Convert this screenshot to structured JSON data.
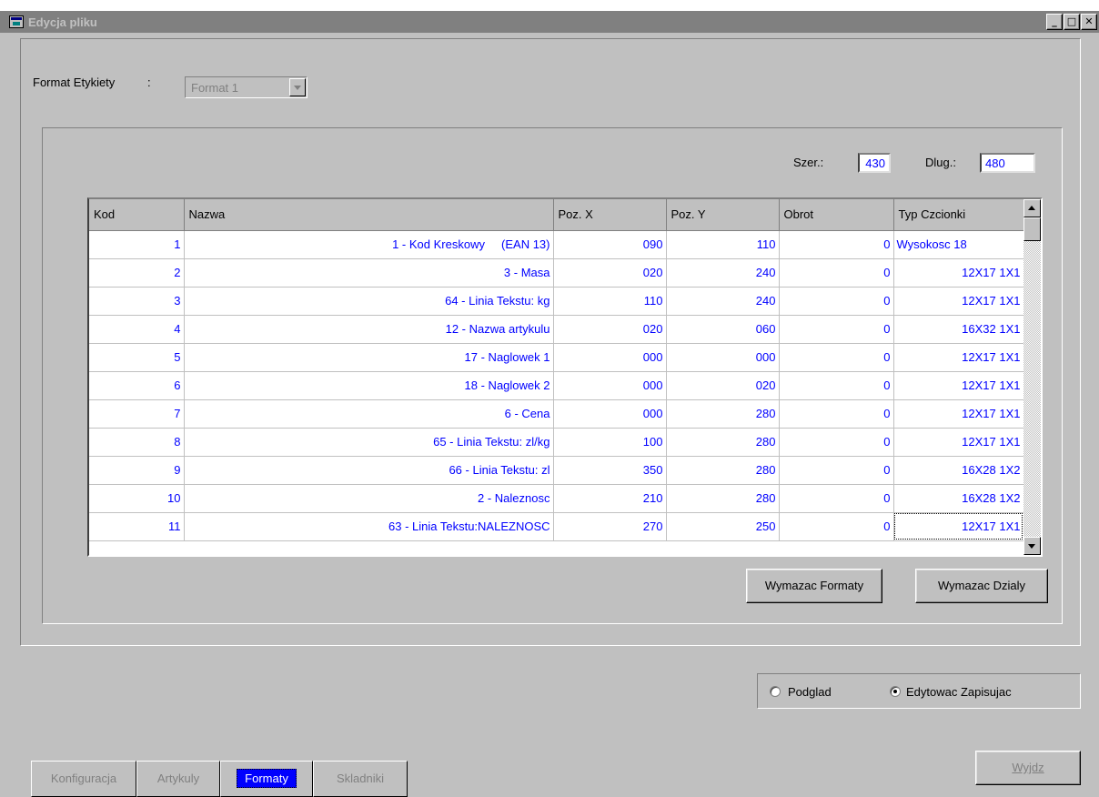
{
  "window": {
    "title": "Edycja pliku",
    "minimize": "_",
    "maximize": "□",
    "close": "✕"
  },
  "format": {
    "label": "Format Etykiety",
    "colon": ":",
    "value": "Format 1"
  },
  "dims": {
    "szer_label": "Szer.:",
    "szer_value": "430",
    "dlug_label": "Dlug.:",
    "dlug_value": "480"
  },
  "table": {
    "columns": [
      "Kod",
      "Nazwa",
      "Poz. X",
      "Poz. Y",
      "Obrot",
      "Typ Czcionki"
    ],
    "rows": [
      {
        "kod": "1",
        "nazwa": "1 - Kod Kreskowy     (EAN 13)",
        "x": "090",
        "y": "110",
        "obrot": "0",
        "typ": "Wysokosc 18"
      },
      {
        "kod": "2",
        "nazwa": "3 - Masa",
        "x": "020",
        "y": "240",
        "obrot": "0",
        "typ": "12X17 1X1"
      },
      {
        "kod": "3",
        "nazwa": "64 - Linia Tekstu: kg",
        "x": "110",
        "y": "240",
        "obrot": "0",
        "typ": "12X17 1X1"
      },
      {
        "kod": "4",
        "nazwa": "12 - Nazwa artykulu",
        "x": "020",
        "y": "060",
        "obrot": "0",
        "typ": "16X32 1X1"
      },
      {
        "kod": "5",
        "nazwa": "17 - Naglowek 1",
        "x": "000",
        "y": "000",
        "obrot": "0",
        "typ": "12X17 1X1"
      },
      {
        "kod": "6",
        "nazwa": "18 - Naglowek 2",
        "x": "000",
        "y": "020",
        "obrot": "0",
        "typ": "12X17 1X1"
      },
      {
        "kod": "7",
        "nazwa": "6 - Cena",
        "x": "000",
        "y": "280",
        "obrot": "0",
        "typ": "12X17 1X1"
      },
      {
        "kod": "8",
        "nazwa": "65 - Linia Tekstu: zl/kg",
        "x": "100",
        "y": "280",
        "obrot": "0",
        "typ": "12X17 1X1"
      },
      {
        "kod": "9",
        "nazwa": "66 - Linia Tekstu: zl",
        "x": "350",
        "y": "280",
        "obrot": "0",
        "typ": "16X28 1X2"
      },
      {
        "kod": "10",
        "nazwa": "2 - Naleznosc",
        "x": "210",
        "y": "280",
        "obrot": "0",
        "typ": "16X28 1X2"
      },
      {
        "kod": "11",
        "nazwa": "63 - Linia Tekstu:NALEZNOSC",
        "x": "270",
        "y": "250",
        "obrot": "0",
        "typ": "12X17 1X1"
      }
    ]
  },
  "buttons": {
    "wymazac_formaty": "Wymazac Formaty",
    "wymazac_dzialy": "Wymazac Dzialy",
    "wyjdz": "Wyjdz"
  },
  "mode": {
    "podglad": "Podglad",
    "edytowac": "Edytowac Zapisujac",
    "selected": "edytowac"
  },
  "tabs": [
    {
      "label": "Konfiguracja",
      "active": false
    },
    {
      "label": "Artykuly",
      "active": false
    },
    {
      "label": "Formaty",
      "active": true
    },
    {
      "label": "Skladniki",
      "active": false
    }
  ],
  "icons": {
    "app": "window-app-icon",
    "scroll_up": "scroll-up-arrow-icon",
    "scroll_down": "scroll-down-arrow-icon",
    "combo": "chevron-down-icon"
  }
}
